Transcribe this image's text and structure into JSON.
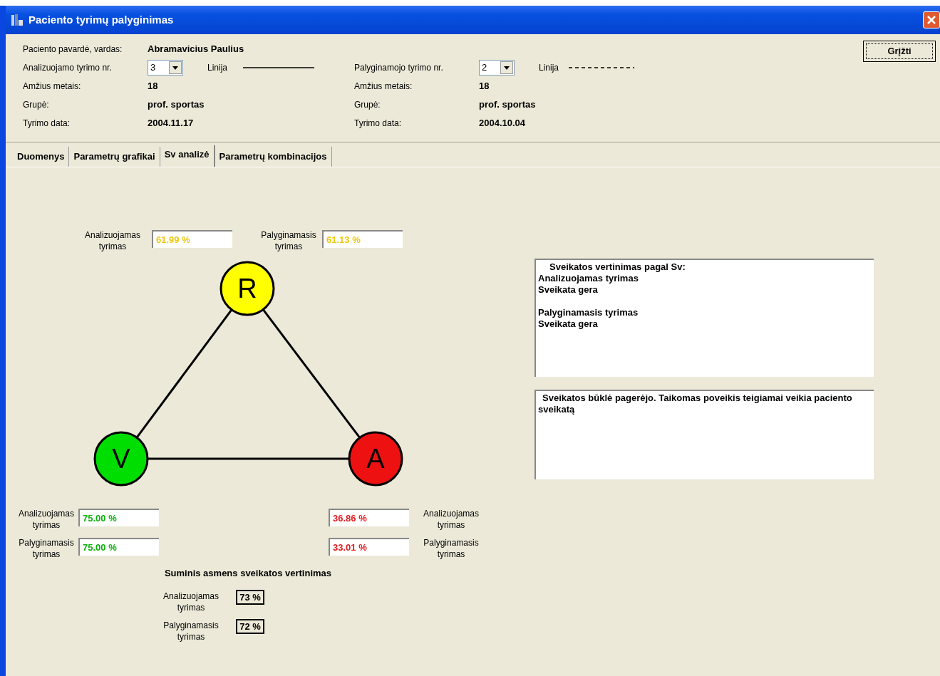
{
  "window": {
    "title": "Paciento tyrimų palyginimas"
  },
  "patient": {
    "label": "Paciento pavardė, vardas:",
    "value": "Abramavicius Paulius"
  },
  "studies": [
    {
      "number_label": "Analizuojamo tyrimo nr.",
      "number": "3",
      "line_label": "Linija",
      "dashed": false,
      "fields": [
        {
          "label": "Amžius metais:",
          "value": "18"
        },
        {
          "label": "Grupė:",
          "value": "prof. sportas"
        },
        {
          "label": "Tyrimo data:",
          "value": "2004.11.17"
        }
      ]
    },
    {
      "number_label": "Palyginamojo tyrimo nr.",
      "number": "2",
      "line_label": "Linija",
      "dashed": true,
      "fields": [
        {
          "label": "Amžius metais:",
          "value": "18"
        },
        {
          "label": "Grupė:",
          "value": "prof. sportas"
        },
        {
          "label": "Tyrimo data:",
          "value": "2004.10.04"
        }
      ]
    }
  ],
  "back_button": "Grįžti",
  "tabs": [
    {
      "label": "Duomenys",
      "selected": false
    },
    {
      "label": "Parametrų grafikai",
      "selected": false
    },
    {
      "label": "Sv analizė",
      "selected": true
    },
    {
      "label": "Parametrų kombinacijos",
      "selected": false
    }
  ],
  "nodes": [
    {
      "letter": "R",
      "color": "#ffff00",
      "readings": [
        {
          "label": "Analizuojamas tyrimas",
          "value": "61.99 %"
        },
        {
          "label": "Palyginamasis tyrimas",
          "value": "61.13 %"
        }
      ]
    },
    {
      "letter": "V",
      "color": "#00dd00",
      "readings": [
        {
          "label": "Analizuojamas tyrimas",
          "value": "75.00 %"
        },
        {
          "label": "Palyginamasis tyrimas",
          "value": "75.00 %"
        }
      ]
    },
    {
      "letter": "A",
      "color": "#ee1111",
      "readings": [
        {
          "label": "Analizuojamas tyrimas",
          "value": "36.86 %"
        },
        {
          "label": "Palyginamasis tyrimas",
          "value": "33.01 %"
        }
      ]
    }
  ],
  "summary": {
    "title": "Suminis asmens sveikatos vertinimas",
    "rows": [
      {
        "label": "Analizuojamas tyrimas",
        "value": "73 %"
      },
      {
        "label": "Palyginamasis tyrimas",
        "value": "72 %"
      }
    ]
  },
  "assessment": {
    "title": "Sveikatos vertinimas pagal Sv:",
    "sections": [
      [
        "Analizuojamas tyrimas",
        "Sveikata gera"
      ],
      [
        "Palyginamasis tyrimas",
        "Sveikata gera"
      ]
    ]
  },
  "conclusion": "Sveikatos būklė pagerėjo. Taikomas poveikis teigiamai veikia paciento sveikatą"
}
